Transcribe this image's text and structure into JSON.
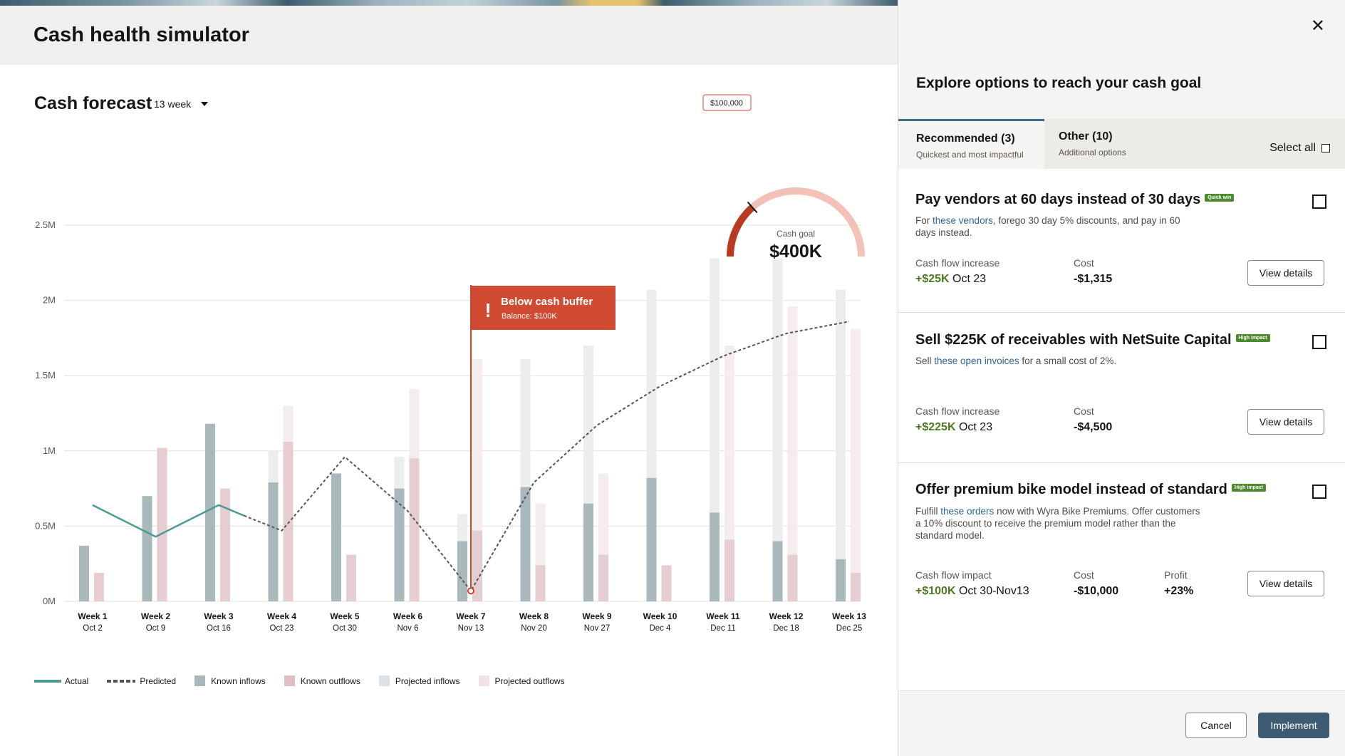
{
  "app": {
    "title": "Cash health simulator"
  },
  "forecast": {
    "title": "Cash forecast",
    "range": "13 week"
  },
  "gauge": {
    "goal_label": "Cash goal",
    "goal_value": "$400K",
    "marker_label": "$100,000",
    "progress": 0.27
  },
  "tooltip": {
    "title": "Below cash buffer",
    "balance": "Balance: $100K",
    "icon": "!"
  },
  "chart_data": {
    "type": "bar",
    "y_ticks": [
      "2.5M",
      "2M",
      "1.5M",
      "1M",
      "0.5M",
      "0M"
    ],
    "ylim": [
      0,
      2500000
    ],
    "categories": [
      {
        "week": "Week 1",
        "date": "Oct 2"
      },
      {
        "week": "Week 2",
        "date": "Oct 9"
      },
      {
        "week": "Week 3",
        "date": "Oct 16"
      },
      {
        "week": "Week 4",
        "date": "Oct 23"
      },
      {
        "week": "Week 5",
        "date": "Oct 30"
      },
      {
        "week": "Week 6",
        "date": "Nov 6"
      },
      {
        "week": "Week 7",
        "date": "Nov 13"
      },
      {
        "week": "Week 8",
        "date": "Nov 20"
      },
      {
        "week": "Week 9",
        "date": "Nov 27"
      },
      {
        "week": "Week 10",
        "date": "Dec 4"
      },
      {
        "week": "Week 11",
        "date": "Dec 11"
      },
      {
        "week": "Week 12",
        "date": "Dec 18"
      },
      {
        "week": "Week 13",
        "date": "Dec 25"
      }
    ],
    "series": [
      {
        "name": "Known inflows",
        "color": "#a9b9bb",
        "values": [
          370000,
          700000,
          1180000,
          790000,
          850000,
          750000,
          400000,
          760000,
          650000,
          820000,
          590000,
          400000,
          280000
        ]
      },
      {
        "name": "Known outflows",
        "color": "#e6cdd2",
        "values": [
          190000,
          1020000,
          750000,
          1060000,
          310000,
          950000,
          470000,
          240000,
          310000,
          240000,
          410000,
          310000,
          190000
        ]
      },
      {
        "name": "Projected inflows",
        "color": "#eceeee",
        "values": [
          0,
          0,
          0,
          1000000,
          0,
          960000,
          580000,
          1610000,
          1700000,
          2070000,
          2280000,
          2280000,
          2070000
        ]
      },
      {
        "name": "Projected outflows",
        "color": "#f5eced",
        "values": [
          0,
          0,
          0,
          1300000,
          0,
          1410000,
          1610000,
          650000,
          850000,
          0,
          1700000,
          1960000,
          1810000
        ]
      },
      {
        "name": "Actual",
        "color": "#4a9a96",
        "values": [
          640000,
          430000,
          640000,
          570000
        ]
      },
      {
        "name": "Predicted",
        "color": "#555555",
        "values": [
          570000,
          470000,
          960000,
          600000,
          70000,
          790000,
          1170000,
          1430000,
          1630000,
          1780000,
          1860000
        ]
      }
    ],
    "predicted_start_week": 3.5
  },
  "legend": [
    "Actual",
    "Predicted",
    "Known inflows",
    "Known outflows",
    "Projected inflows",
    "Projected outflows"
  ],
  "panel": {
    "title": "Explore options to reach your cash goal",
    "tabs": [
      {
        "label": "Recommended (3)",
        "sub": "Quickest and most impactful"
      },
      {
        "label": "Other (10)",
        "sub": "Additional options"
      }
    ],
    "select_all": "Select all",
    "cards": [
      {
        "title": "Pay vendors at 60 days instead of 30 days",
        "badge": "Quick win",
        "desc_pre": "For ",
        "desc_link": "these vendors",
        "desc_post": ", forego 30 day 5% discounts, and pay in 60 days instead.",
        "m1_label": "Cash flow increase",
        "m1_value": "+$25K",
        "m1_date": "Oct 23",
        "m2_label": "Cost",
        "m2_value": "-$1,315",
        "button": "View details"
      },
      {
        "title": "Sell $225K of receivables with NetSuite Capital",
        "badge": "High impact",
        "desc_pre": "Sell ",
        "desc_link": "these open invoices",
        "desc_post": " for a small cost of 2%.",
        "m1_label": "Cash flow increase",
        "m1_value": "+$225K",
        "m1_date": "Oct 23",
        "m2_label": "Cost",
        "m2_value": "-$4,500",
        "button": "View details"
      },
      {
        "title": "Offer premium bike model instead of standard",
        "badge": "High impact",
        "desc_pre": "Fulfill ",
        "desc_link": "these orders",
        "desc_post": " now with Wyra Bike Premiums. Offer customers a 10% discount to receive the premium model rather than the standard model.",
        "m1_label": "Cash flow impact",
        "m1_value": "+$100K",
        "m1_date": "Oct 30-Nov13",
        "m2_label": "Cost",
        "m2_value": "-$10,000",
        "m3_label": "Profit",
        "m3_value": "+23%",
        "button": "View details"
      }
    ],
    "cancel": "Cancel",
    "implement": "Implement"
  }
}
